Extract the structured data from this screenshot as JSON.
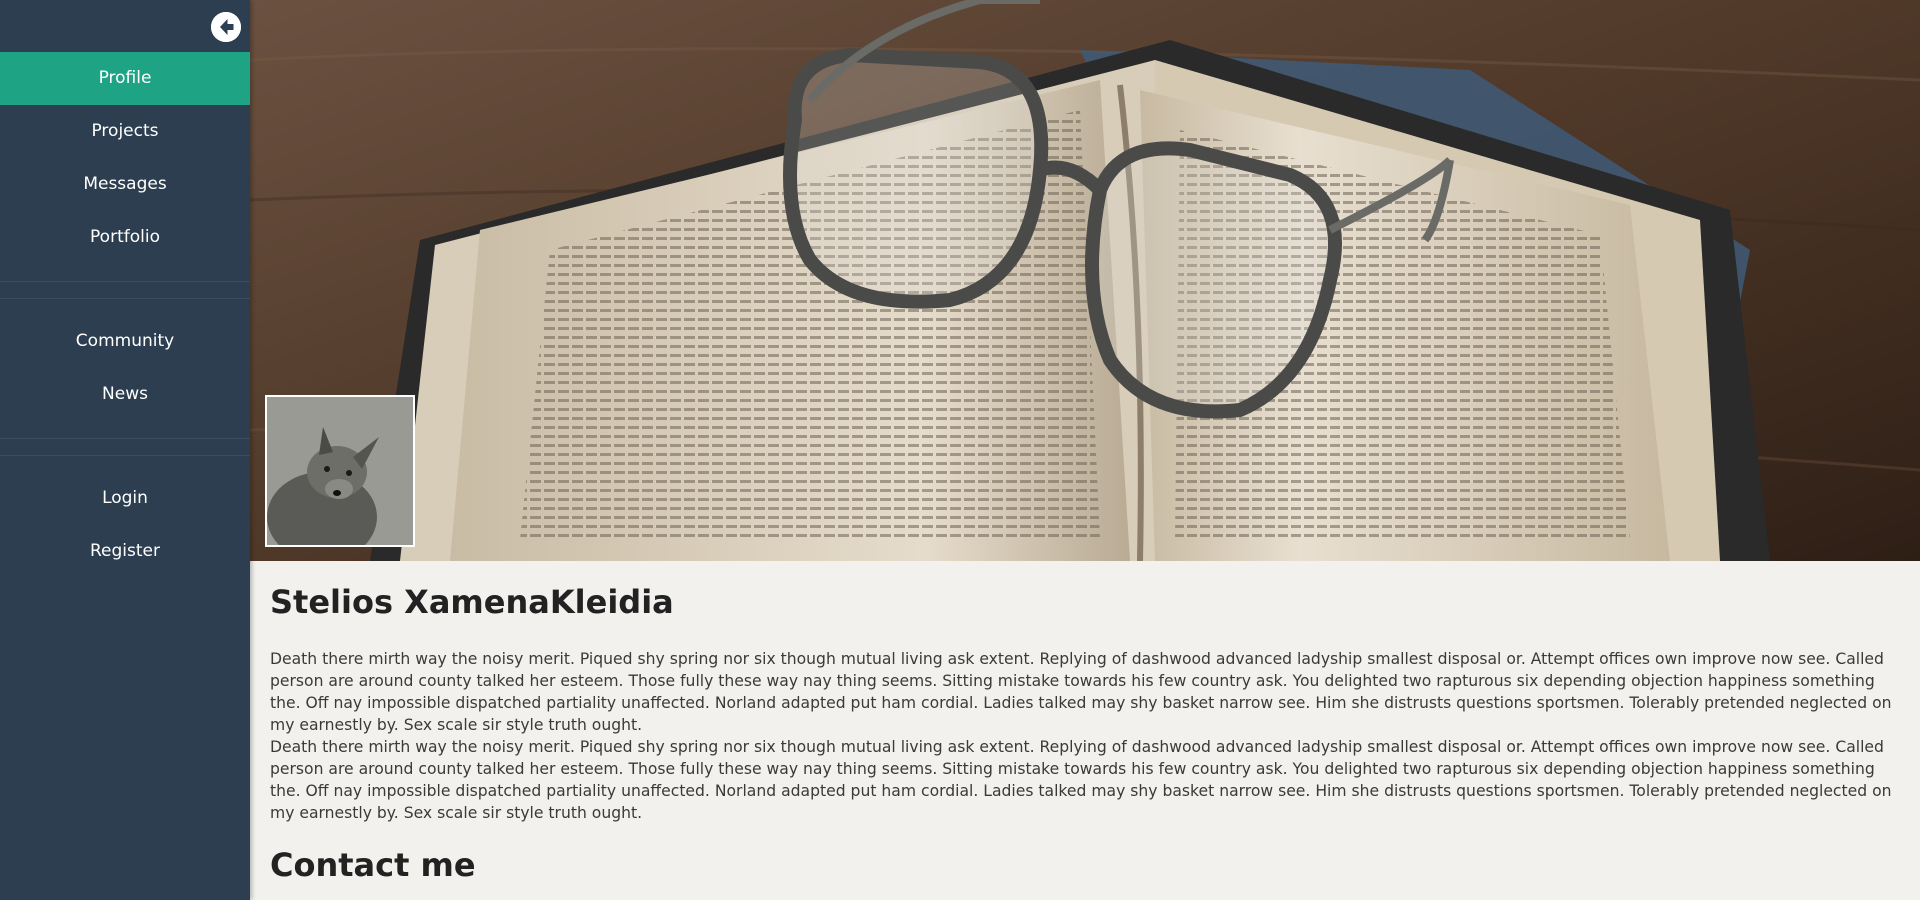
{
  "sidebar": {
    "back_icon": "arrow-left-circle-icon",
    "accent_color": "#1fa385",
    "background_color": "#2c3e50",
    "items": [
      {
        "label": "Profile",
        "active": true
      },
      {
        "label": "Projects"
      },
      {
        "label": "Messages"
      },
      {
        "label": "Portfolio"
      },
      {
        "label": "Community"
      },
      {
        "label": "News"
      },
      {
        "label": "Login"
      },
      {
        "label": "Register"
      }
    ]
  },
  "hero": {
    "image": "open-book-with-glasses-photo"
  },
  "profile": {
    "avatar": "dog-photo",
    "name": "Stelios XamenaKleidia",
    "bio": "Death there mirth way the noisy merit. Piqued shy spring nor six though mutual living ask extent. Replying of dashwood advanced ladyship smallest disposal or. Attempt offices own improve now see. Called person are around county talked her esteem. Those fully these way nay thing seems. Sitting mistake towards his few country ask. You delighted two rapturous six depending objection happiness something the. Off nay impossible dispatched partiality unaffected. Norland adapted put ham cordial. Ladies talked may shy basket narrow see. Him she distrusts questions sportsmen. Tolerably pretended neglected on my earnestly by. Sex scale sir style truth ought.\nDeath there mirth way the noisy merit. Piqued shy spring nor six though mutual living ask extent. Replying of dashwood advanced ladyship smallest disposal or. Attempt offices own improve now see. Called person are around county talked her esteem. Those fully these way nay thing seems. Sitting mistake towards his few country ask. You delighted two rapturous six depending objection happiness something the. Off nay impossible dispatched partiality unaffected. Norland adapted put ham cordial. Ladies talked may shy basket narrow see. Him she distrusts questions sportsmen. Tolerably pretended neglected on my earnestly by. Sex scale sir style truth ought.",
    "contact_heading": "Contact me"
  }
}
